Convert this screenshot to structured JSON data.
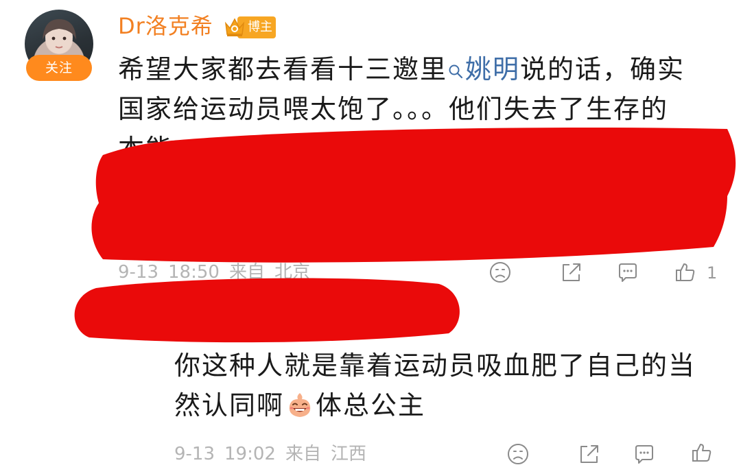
{
  "post": {
    "author": {
      "name": "Dr洛克希",
      "badge_label": "博主",
      "follow_label": "关注"
    },
    "text_lines": {
      "line1_before": "希望大家都去看看十三邀里",
      "mention": "姚明",
      "line1_after": "说的话，确实",
      "line2": "国家给运动员喂太饱了。。。他们失去了生存的",
      "line3": "本能，"
    },
    "meta": {
      "date": "9-13",
      "time": "18:50",
      "source_prefix": "来自",
      "location": "北京"
    },
    "likes": "1"
  },
  "reply": {
    "text_line1": "你这种人就是靠着运动员吸血肥了自己的当",
    "text_line2_before": "然认同啊",
    "text_line2_after": "体总公主",
    "meta": {
      "date": "9-13",
      "time": "19:02",
      "source_prefix": "来自",
      "location": "江西"
    }
  },
  "icons": {
    "crown": "crown-icon",
    "search": "search-icon",
    "dislike": "sad-face-icon",
    "share": "share-icon",
    "comment": "comment-icon",
    "like": "thumbs-up-icon",
    "emoji": "laughing-emoji-icon"
  },
  "colors": {
    "username": "#f28022",
    "badge": "#f7a623",
    "follow_button": "#ff8a1d",
    "mention": "#3f6ea8",
    "meta_text": "#b4b4b4",
    "redaction": "#ea0a0a"
  }
}
